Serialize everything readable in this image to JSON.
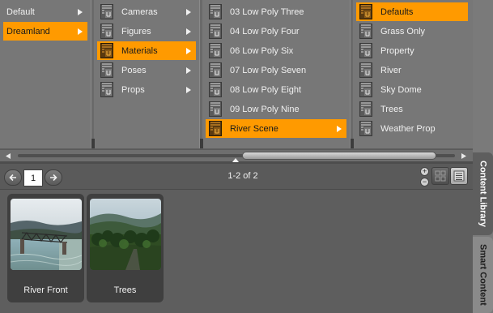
{
  "browser": {
    "col1": [
      {
        "label": "Default",
        "selected": false,
        "has_arrow": true
      },
      {
        "label": "Dreamland",
        "selected": true,
        "has_arrow": true
      }
    ],
    "col2": [
      {
        "label": "Cameras",
        "selected": false,
        "has_arrow": true
      },
      {
        "label": "Figures",
        "selected": false,
        "has_arrow": true
      },
      {
        "label": "Materials",
        "selected": true,
        "has_arrow": true
      },
      {
        "label": "Poses",
        "selected": false,
        "has_arrow": true
      },
      {
        "label": "Props",
        "selected": false,
        "has_arrow": true
      }
    ],
    "col3": [
      {
        "label": "03 Low Poly Three",
        "selected": false,
        "has_arrow": false
      },
      {
        "label": "04 Low Poly Four",
        "selected": false,
        "has_arrow": false
      },
      {
        "label": "06 Low Poly Six",
        "selected": false,
        "has_arrow": false
      },
      {
        "label": "07 Low Poly Seven",
        "selected": false,
        "has_arrow": false
      },
      {
        "label": "08 Low Poly Eight",
        "selected": false,
        "has_arrow": false
      },
      {
        "label": "09 Low Poly Nine",
        "selected": false,
        "has_arrow": false
      },
      {
        "label": "River Scene",
        "selected": true,
        "has_arrow": true
      }
    ],
    "col4": [
      {
        "label": "Defaults",
        "selected": true,
        "has_arrow": false
      },
      {
        "label": "Grass Only",
        "selected": false,
        "has_arrow": false
      },
      {
        "label": "Property",
        "selected": false,
        "has_arrow": false
      },
      {
        "label": "River",
        "selected": false,
        "has_arrow": false
      },
      {
        "label": "Sky Dome",
        "selected": false,
        "has_arrow": false
      },
      {
        "label": "Trees",
        "selected": false,
        "has_arrow": false
      },
      {
        "label": "Weather Prop",
        "selected": false,
        "has_arrow": false
      }
    ],
    "folder_icon": "folder-doc-icon",
    "selected_color": "#ff9a00"
  },
  "toolbar": {
    "page": "1",
    "count_text": "1-2 of 2",
    "zoom_in": "+",
    "zoom_out": "−"
  },
  "thumbnails": [
    {
      "label": "River Front",
      "icon": "river-front-thumbnail"
    },
    {
      "label": "Trees",
      "icon": "trees-thumbnail"
    }
  ],
  "tabs": {
    "content_library": "Content Library",
    "smart_content": "Smart Content"
  },
  "colors": {
    "accent": "#ff9a00",
    "panel": "#777777",
    "background": "#5e5e5e"
  }
}
